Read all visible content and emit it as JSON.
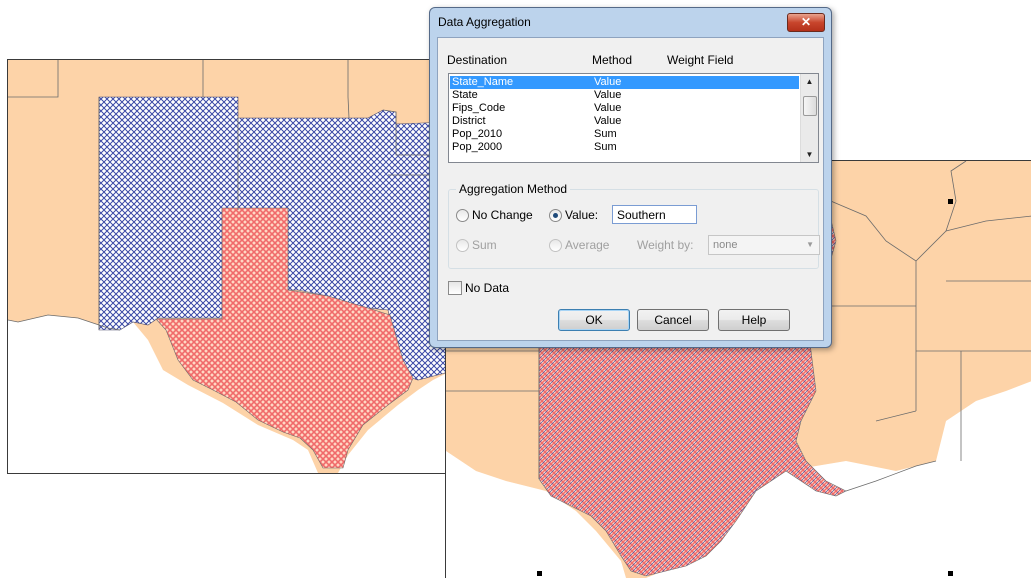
{
  "dialog": {
    "title": "Data Aggregation",
    "close_glyph": "✕",
    "columns": {
      "destination": "Destination",
      "method": "Method",
      "weight_field": "Weight Field"
    },
    "fields": [
      {
        "name": "State_Name",
        "method": "Value",
        "selected": true
      },
      {
        "name": "State",
        "method": "Value",
        "selected": false
      },
      {
        "name": "Fips_Code",
        "method": "Value",
        "selected": false
      },
      {
        "name": "District",
        "method": "Value",
        "selected": false
      },
      {
        "name": "Pop_2010",
        "method": "Sum",
        "selected": false
      },
      {
        "name": "Pop_2000",
        "method": "Sum",
        "selected": false
      }
    ],
    "aggregation": {
      "group_label": "Aggregation Method",
      "no_change_label": "No Change",
      "value_label": "Value:",
      "value_input": "Southern",
      "sum_label": "Sum",
      "average_label": "Average",
      "weight_by_label": "Weight by:",
      "weight_by_value": "none",
      "selected_option": "value"
    },
    "no_data_label": "No Data",
    "no_data_checked": false,
    "buttons": {
      "ok": "OK",
      "cancel": "Cancel",
      "help": "Help"
    }
  },
  "map": {
    "colors": {
      "land": "#fdd3a8",
      "hatch_blue": "#3a48a6",
      "hatch_red": "#f06a6a",
      "water": "#ffffff",
      "border": "#6b6b6b"
    },
    "icons": {
      "close": "close-icon",
      "scroll_up": "arrow-up-icon",
      "scroll_down": "arrow-down-icon",
      "dropdown": "chevron-down-icon"
    }
  }
}
